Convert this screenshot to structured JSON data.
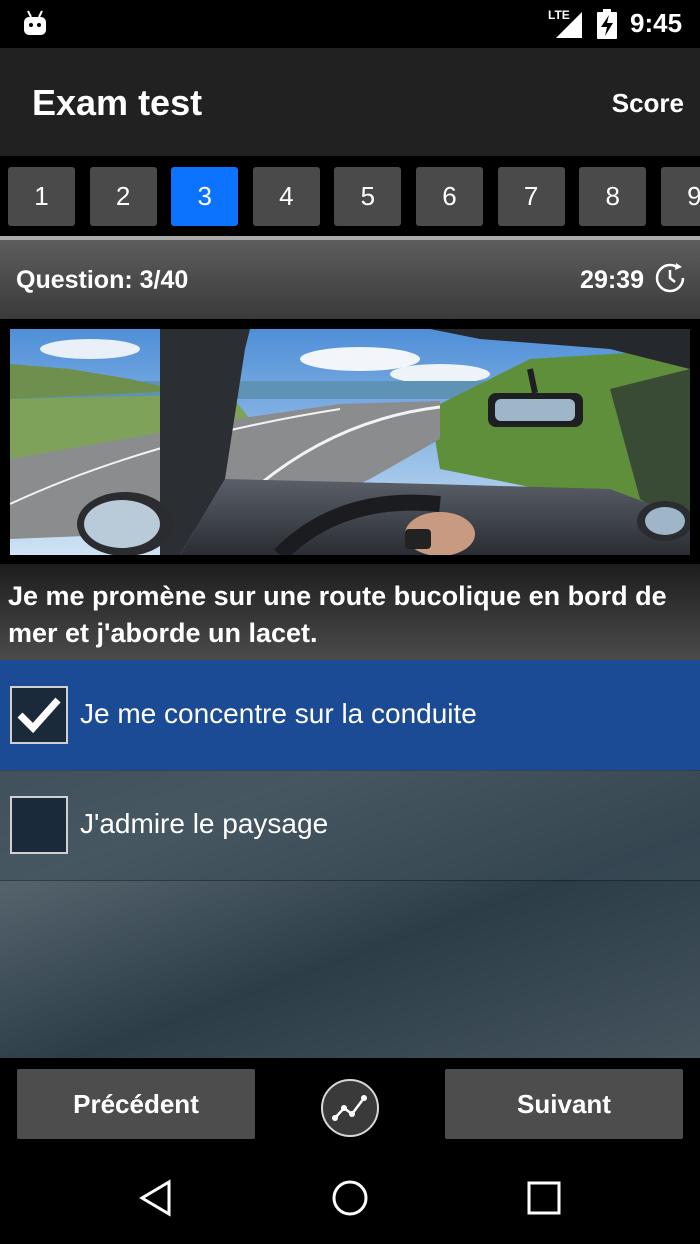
{
  "status_bar": {
    "network": "LTE",
    "time": "9:45"
  },
  "app_bar": {
    "title": "Exam test",
    "score_label": "Score"
  },
  "question_tabs": [
    "1",
    "2",
    "3",
    "4",
    "5",
    "6",
    "7",
    "8",
    "9"
  ],
  "active_question_tab": "3",
  "question_header": {
    "counter": "Question: 3/40",
    "timer": "29:39"
  },
  "question": {
    "text": "Je me promène sur une route bucolique en bord de mer et j'aborde un lacet.",
    "answers": [
      {
        "label": "Je me concentre sur la conduite",
        "checked": true
      },
      {
        "label": "J'admire le paysage",
        "checked": false
      }
    ]
  },
  "bottom_bar": {
    "prev_label": "Précédent",
    "next_label": "Suivant"
  },
  "colors": {
    "active_tab": "#0b73ff",
    "selected_answer": "#1b4b95",
    "app_bar": "#212121"
  }
}
